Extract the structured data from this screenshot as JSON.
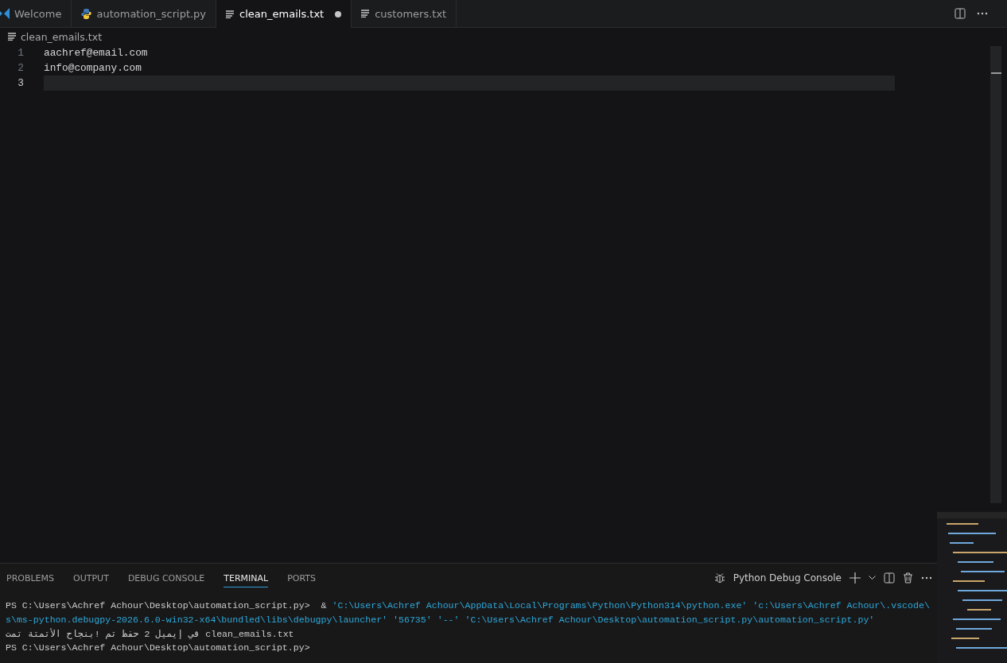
{
  "tabs": [
    {
      "label": "Welcome",
      "kind": "app",
      "selected": false,
      "modified": false
    },
    {
      "label": "automation_script.py",
      "kind": "script",
      "selected": false,
      "modified": false
    },
    {
      "label": "clean_emails.txt",
      "kind": "text",
      "selected": true,
      "modified": true
    },
    {
      "label": "customers.txt",
      "kind": "text",
      "selected": false,
      "modified": false
    }
  ],
  "breadcrumb": "clean_emails.txt",
  "editor": {
    "lines": [
      {
        "number": "1",
        "text": "aachref@email.com",
        "current": false
      },
      {
        "number": "2",
        "text": "info@company.com",
        "current": false
      },
      {
        "number": "3",
        "current": true
      }
    ]
  },
  "panel": {
    "tabs": [
      {
        "label": "PROBLEMS",
        "selected": false
      },
      {
        "label": "OUTPUT",
        "selected": false
      },
      {
        "label": "DEBUG CONSOLE",
        "selected": false
      },
      {
        "label": "TERMINAL",
        "selected": true
      },
      {
        "label": "PORTS",
        "selected": false
      }
    ],
    "terminal_name": "Python Debug Console",
    "terminal_lines": [
      [
        {
          "kind": "prompt",
          "text": "PS C:\\Users\\Achref Achour\\Desktop\\automation_script.py>  & "
        },
        {
          "kind": "string",
          "text": "'C:\\Users\\Achref Achour\\AppData\\Local\\Programs\\Python\\Python314\\python.exe' 'c:\\Users\\Achref Achour\\.vscode\\"
        }
      ],
      [
        {
          "kind": "string",
          "text": "s\\ms-python.debugpy-2026.6.0-win32-x64\\bundled\\libs\\debugpy\\launcher' '56735' '--' 'C:\\Users\\Achref Achour\\Desktop\\automation_script.py\\automation_script.py'"
        }
      ],
      [
        {
          "kind": "output",
          "text": "تمت الأتمتة بنجاح! تم حفظ 2 إيميل في clean_emails.txt"
        }
      ],
      [
        {
          "kind": "prompt",
          "text": "PS C:\\Users\\Achref Achour\\Desktop\\automation_script.py>"
        }
      ]
    ]
  }
}
